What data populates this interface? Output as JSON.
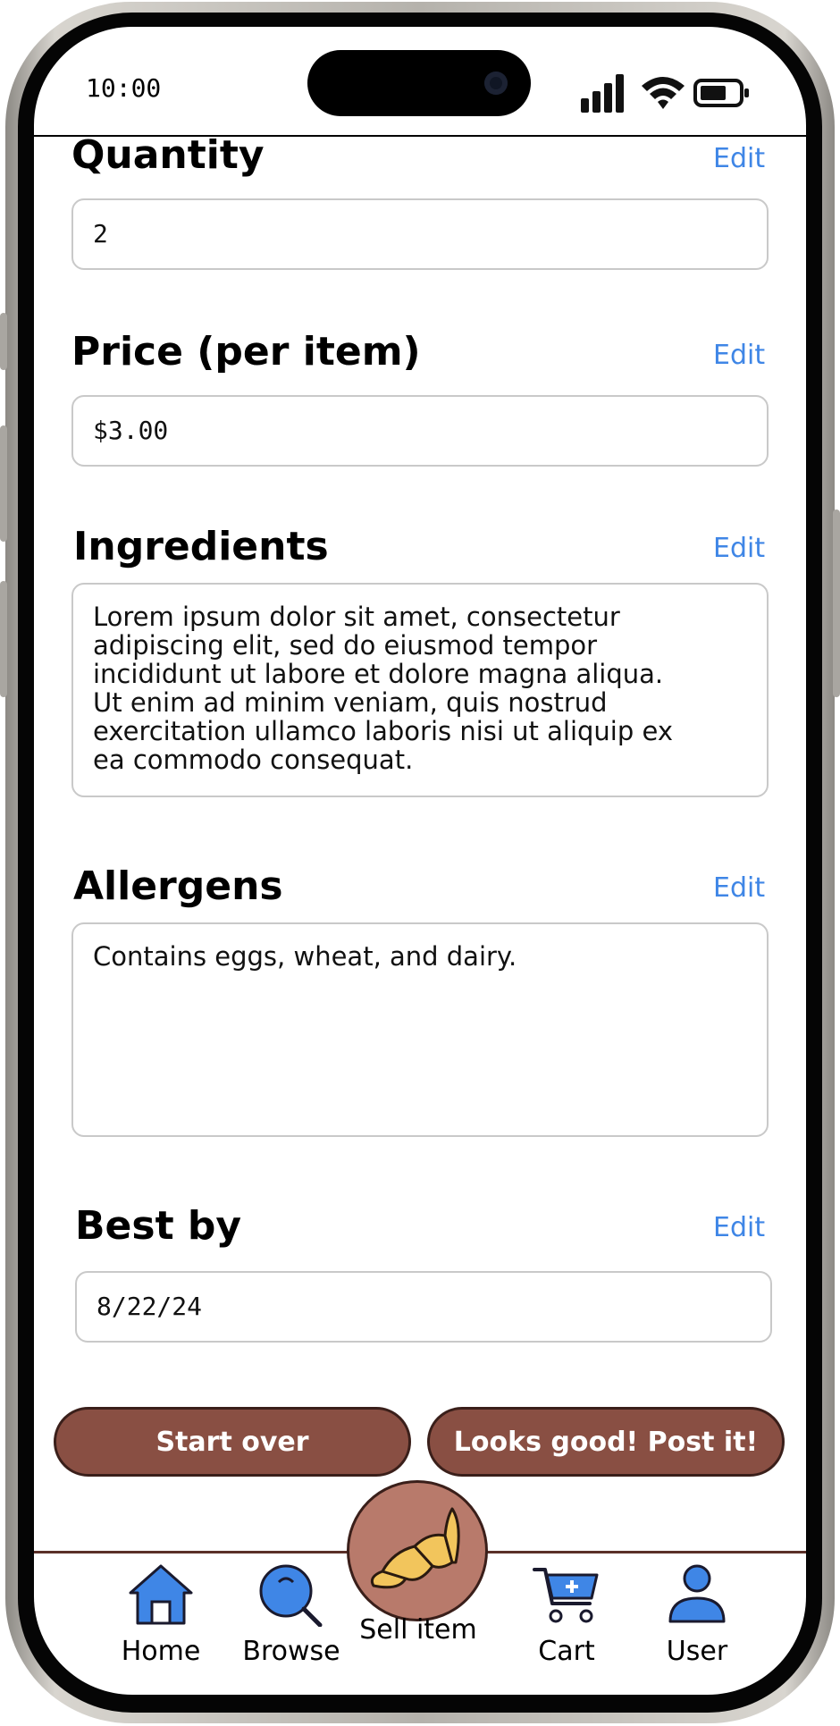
{
  "status_bar": {
    "time": "10:00"
  },
  "form": {
    "quantity": {
      "label": "Quantity",
      "edit": "Edit",
      "value": "2"
    },
    "price": {
      "label": "Price (per item)",
      "edit": "Edit",
      "value": "$3.00"
    },
    "ingredients": {
      "label": "Ingredients",
      "edit": "Edit",
      "value": "Lorem ipsum dolor sit amet, consectetur\nadipiscing elit, sed do eiusmod tempor\nincididunt ut labore et dolore magna aliqua.\nUt enim ad minim veniam, quis nostrud\nexercitation ullamco laboris nisi ut aliquip ex\nea commodo consequat."
    },
    "allergens": {
      "label": "Allergens",
      "edit": "Edit",
      "value": "Contains eggs, wheat, and dairy."
    },
    "best_by": {
      "label": "Best by",
      "edit": "Edit",
      "value": "8/22/24"
    }
  },
  "actions": {
    "start_over": "Start over",
    "post": "Looks good! Post it!"
  },
  "nav": {
    "home": "Home",
    "browse": "Browse",
    "sell": "Sell item",
    "cart": "Cart",
    "user": "User"
  },
  "colors": {
    "accent": "#3f86e6",
    "button_brown": "#894f43",
    "sell_circle": "#b87a6b",
    "croissant": "#f2c55c"
  },
  "icons": [
    "signal-icon",
    "wifi-icon",
    "battery-icon",
    "home-icon",
    "search-icon",
    "croissant-icon",
    "cart-icon",
    "user-icon"
  ]
}
